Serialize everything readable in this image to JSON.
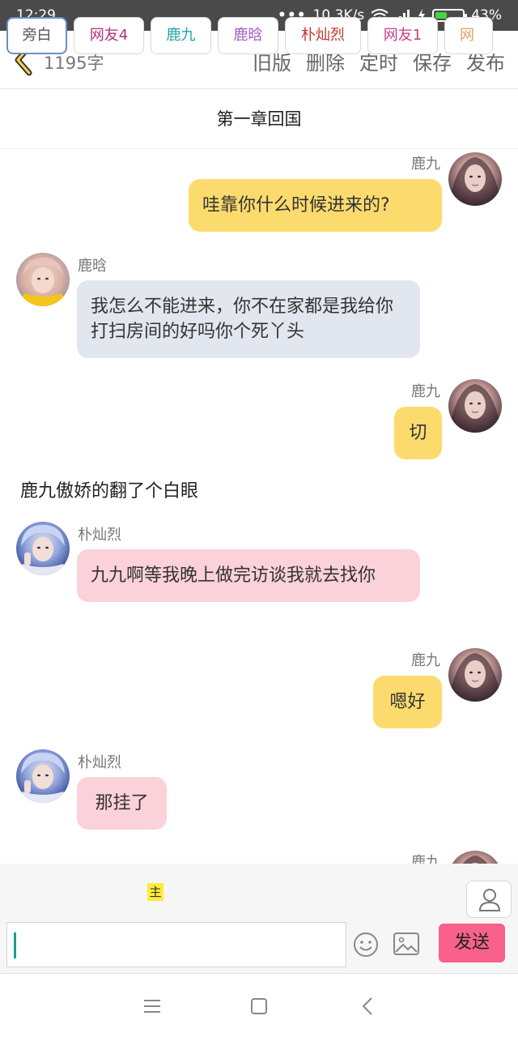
{
  "status_bar": {
    "time": "12:29",
    "dots": "•••",
    "network_speed": "10.3K/s",
    "battery_percent": "43%",
    "battery_level": 0.43
  },
  "header": {
    "word_count": "1195字",
    "actions": [
      "旧版",
      "删除",
      "定时",
      "保存",
      "发布"
    ]
  },
  "chapter_title": "第一章回国",
  "messages": [
    {
      "speaker": "鹿九",
      "text": "哇靠你什么时候进来的?",
      "side": "right"
    },
    {
      "speaker": "鹿晗",
      "text": "我怎么不能进来，你不在家都是我给你打扫房间的好吗你个死丫头",
      "side": "left"
    },
    {
      "speaker": "鹿九",
      "text": "切",
      "side": "right"
    },
    {
      "narration": "鹿九傲娇的翻了个白眼"
    },
    {
      "speaker": "朴灿烈",
      "text": "九九啊等我晚上做完访谈我就去找你",
      "side": "left"
    },
    {
      "speaker": "鹿九",
      "text": "嗯好",
      "side": "right"
    },
    {
      "speaker": "朴灿烈",
      "text": "那挂了",
      "side": "left"
    },
    {
      "speaker": "鹿九",
      "text": "",
      "side": "right"
    }
  ],
  "roles": {
    "main_badge": "主",
    "items": [
      {
        "label": "旁白",
        "color": "#555555"
      },
      {
        "label": "网友4",
        "color": "#b0307a"
      },
      {
        "label": "鹿九",
        "color": "#1fa3a3"
      },
      {
        "label": "鹿晗",
        "color": "#a05ac4"
      },
      {
        "label": "朴灿烈",
        "color": "#c4372b"
      },
      {
        "label": "网友1",
        "color": "#c43f87"
      },
      {
        "label": "网",
        "color": "#e0a060"
      }
    ]
  },
  "input": {
    "value": "",
    "send_label": "发送"
  },
  "colors": {
    "accent": "#f8628a",
    "bubble_self": "#fcdb6e",
    "bubble_luhan": "#e2e6ee",
    "bubble_chanyeol": "#fbd1da"
  }
}
